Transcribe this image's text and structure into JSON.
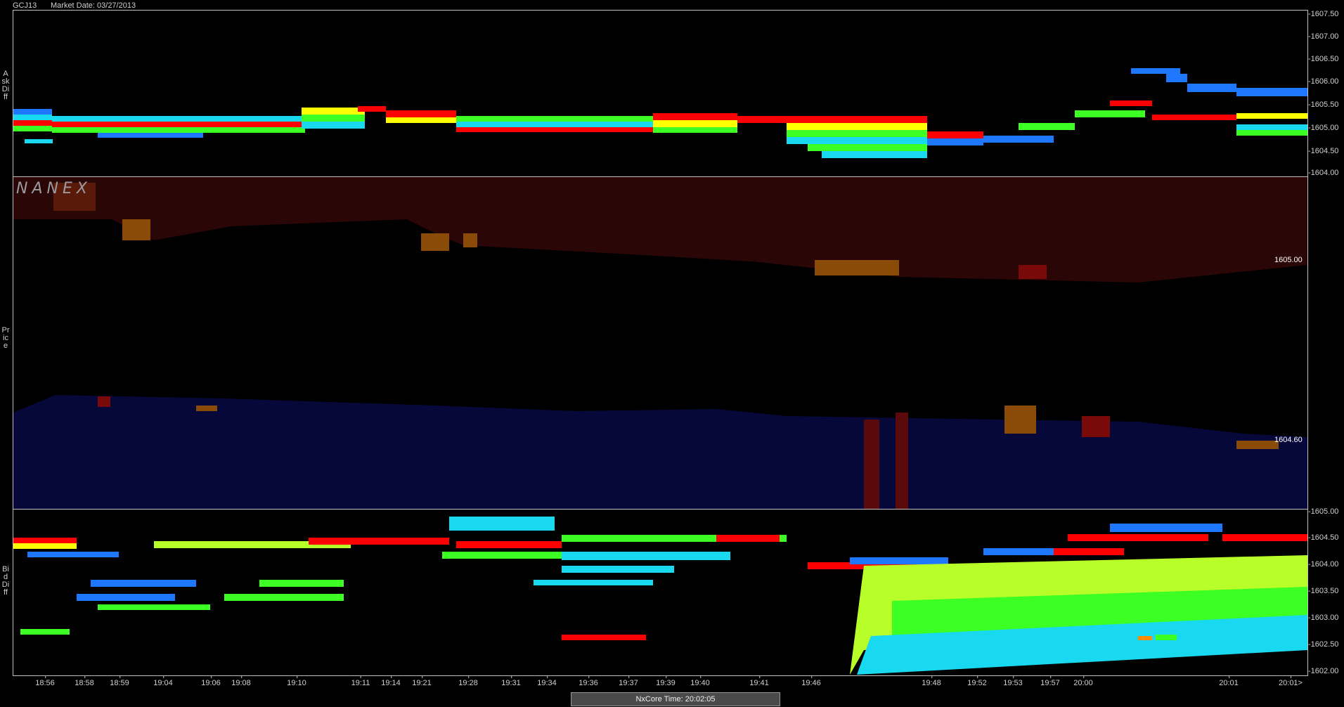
{
  "header": {
    "symbol": "GCJ13",
    "market_date": "Market Date: 03/27/2013"
  },
  "labels": {
    "ask_diff": "AskDiff",
    "price": "Price",
    "bid_diff": "BidDiff"
  },
  "logo": "NANEX",
  "ask_axis": [
    "-1607.50",
    "-1607.00",
    "-1606.50",
    "-1606.00",
    "-1605.50",
    "-1605.00",
    "-1604.50",
    "-1604.00"
  ],
  "bid_axis": [
    "-1605.00",
    "-1604.50",
    "-1604.00",
    "-1603.50",
    "-1603.00",
    "-1602.50",
    "-1602.00"
  ],
  "price_labels": {
    "ask": "1605.00",
    "bid": "1604.60"
  },
  "time_axis": [
    "18:56",
    "18:58",
    "18:59",
    "19:04",
    "19:06",
    "19:08",
    "19:10",
    "19:11",
    "19:14",
    "19:21",
    "19:28",
    "19:31",
    "19:34",
    "19:36",
    "19:37",
    "19:39",
    "19:40",
    "19:41",
    "19:46",
    "19:48",
    "19:52",
    "19:53",
    "19:57",
    "20:00",
    "20:01",
    "20:01>"
  ],
  "status_bar": "NxCore Time: 20:02:05",
  "colors": {
    "ask_shade": "#2a0606",
    "bid_shade": "#07083a",
    "red": "#ff0000",
    "blue": "#1e78ff",
    "cyan": "#19d9f0",
    "green": "#3cff24",
    "lime": "#b8ff2a",
    "yellow": "#ffff00",
    "orange": "#c86a0a",
    "darkred": "#7a0a0a"
  }
}
